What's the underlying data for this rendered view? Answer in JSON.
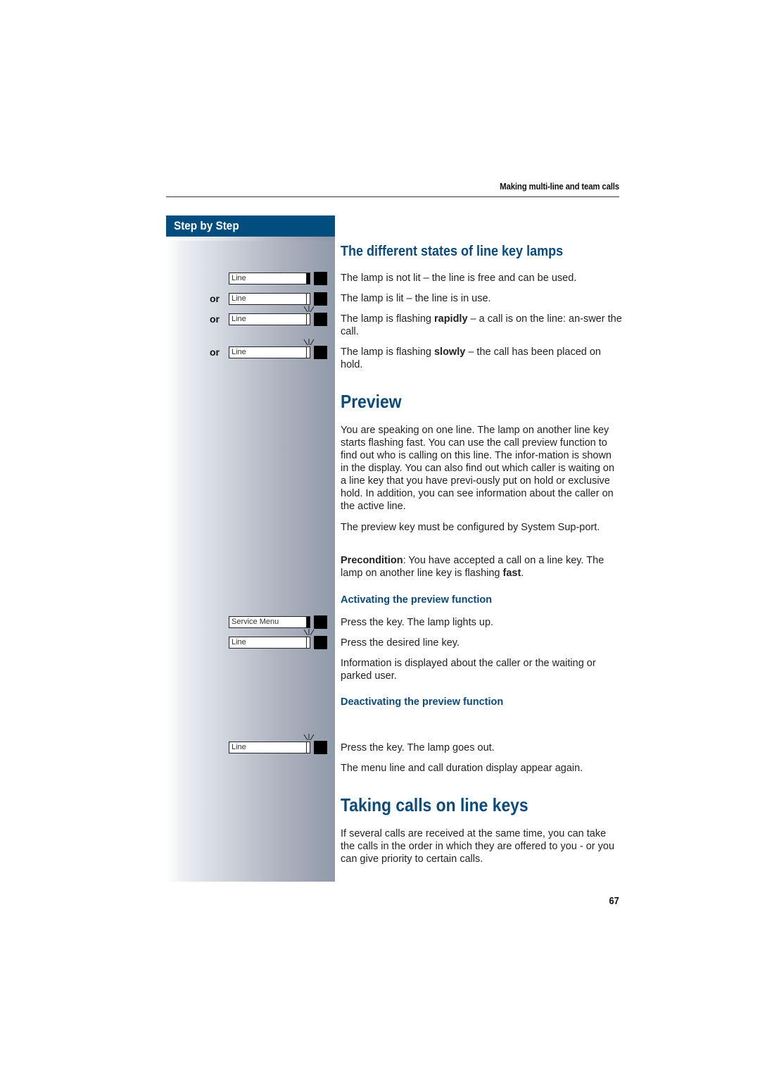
{
  "header": {
    "title": "Making multi-line and team calls"
  },
  "sidebar": {
    "title": "Step by Step",
    "or_label": "or",
    "keys": [
      {
        "label": "Line",
        "lamp": "off",
        "flashing": false
      },
      {
        "label": "Line",
        "lamp": "lit",
        "flashing": false
      },
      {
        "label": "Line",
        "lamp": "lit",
        "flashing": true
      },
      {
        "label": "Line",
        "lamp": "lit",
        "flashing": true
      },
      {
        "label": "Service Menu",
        "lamp": "off",
        "flashing": false
      },
      {
        "label": "Line",
        "lamp": "lit",
        "flashing": true
      },
      {
        "label": "Line",
        "lamp": "lit",
        "flashing": true
      }
    ]
  },
  "section1": {
    "heading": "The different states of line key lamps",
    "items": [
      {
        "pre": "The lamp is not lit – the line is free and can be used.",
        "bold": "",
        "post": ""
      },
      {
        "pre": "The lamp is lit – the line is in use.",
        "bold": "",
        "post": ""
      },
      {
        "pre": "The lamp is flashing ",
        "bold": "rapidly",
        "post": " – a call is on the line: an-swer the call."
      },
      {
        "pre": "The lamp is flashing ",
        "bold": "slowly",
        "post": " – the call has been placed on hold."
      }
    ]
  },
  "preview": {
    "heading": "Preview",
    "intro": "You are speaking on one line. The lamp on another line key starts flashing fast. You can use the call preview function to find out who is calling on this line. The infor-mation is shown in the display. You can also find out which caller is waiting on a line key that you have previ-ously put on hold or exclusive hold. In addition, you can see information about the caller on the active line.",
    "config_note": "The preview key must be configured by System Sup-port.",
    "precondition_label": "Precondition",
    "precondition_text": ": You have accepted a call on a line key. The lamp on another line key is flashing ",
    "precondition_bold": "fast",
    "precondition_end": ".",
    "activating": {
      "heading": "Activating the preview function",
      "step1": "Press the key. The lamp lights up.",
      "step2": "Press the desired line key.",
      "result": "Information is displayed about the caller or the waiting or parked user."
    },
    "deactivating": {
      "heading": "Deactivating the preview function",
      "step1": "Press the key. The lamp goes out.",
      "result": "The menu line and call duration display appear again."
    }
  },
  "taking_calls": {
    "heading": "Taking calls on line keys",
    "text": "If several calls are received at the same time, you can take the calls in the order in which they are offered to you - or you can give priority to certain calls."
  },
  "page_number": "67"
}
